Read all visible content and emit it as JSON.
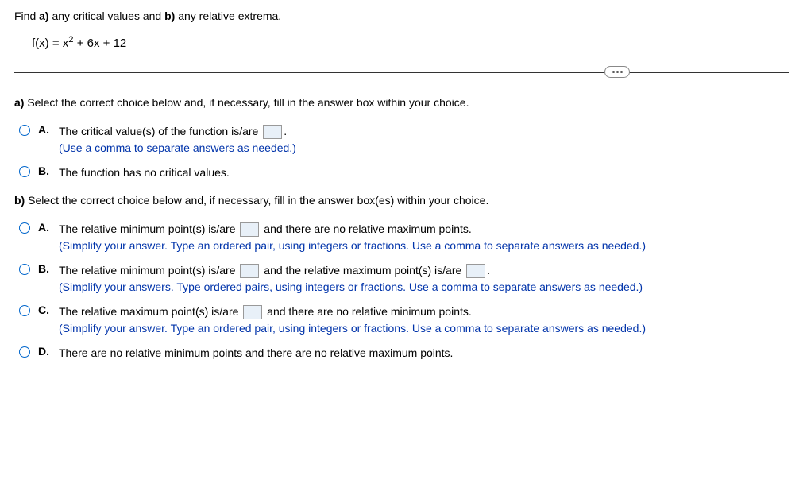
{
  "intro": {
    "prefix": "Find ",
    "a_label": "a)",
    "a_text": " any critical values and ",
    "b_label": "b)",
    "b_text": " any relative extrema."
  },
  "formula": {
    "lhs": "f(x) = x",
    "exp": "2",
    "rest": " + 6x + 12"
  },
  "part_a": {
    "prompt_bold": "a)",
    "prompt_rest": " Select the correct choice below and, if necessary, fill in the answer box within your choice.",
    "choices": {
      "A": {
        "letter": "A.",
        "text1": "The critical value(s) of the function is/are ",
        "text2": ".",
        "hint": "(Use a comma to separate answers as needed.)"
      },
      "B": {
        "letter": "B.",
        "text1": "The function has no critical values."
      }
    }
  },
  "part_b": {
    "prompt_bold": "b)",
    "prompt_rest": " Select the correct choice below and, if necessary, fill in the answer box(es) within your choice.",
    "choices": {
      "A": {
        "letter": "A.",
        "text1": "The relative minimum point(s) is/are ",
        "text2": " and there are no relative maximum points.",
        "hint": "(Simplify your answer. Type an ordered pair, using integers or fractions. Use a comma to separate answers as needed.)"
      },
      "B": {
        "letter": "B.",
        "text1": "The relative minimum point(s) is/are ",
        "text2": " and the relative maximum point(s) is/are ",
        "text3": ".",
        "hint": "(Simplify your answers. Type ordered pairs, using integers or fractions. Use a comma to separate answers as needed.)"
      },
      "C": {
        "letter": "C.",
        "text1": "The relative maximum point(s) is/are ",
        "text2": " and there are no relative minimum points.",
        "hint": "(Simplify your answer. Type an ordered pair, using integers or fractions. Use a comma to separate answers as needed.)"
      },
      "D": {
        "letter": "D.",
        "text1": "There are no relative minimum points and there are no relative maximum points."
      }
    }
  }
}
